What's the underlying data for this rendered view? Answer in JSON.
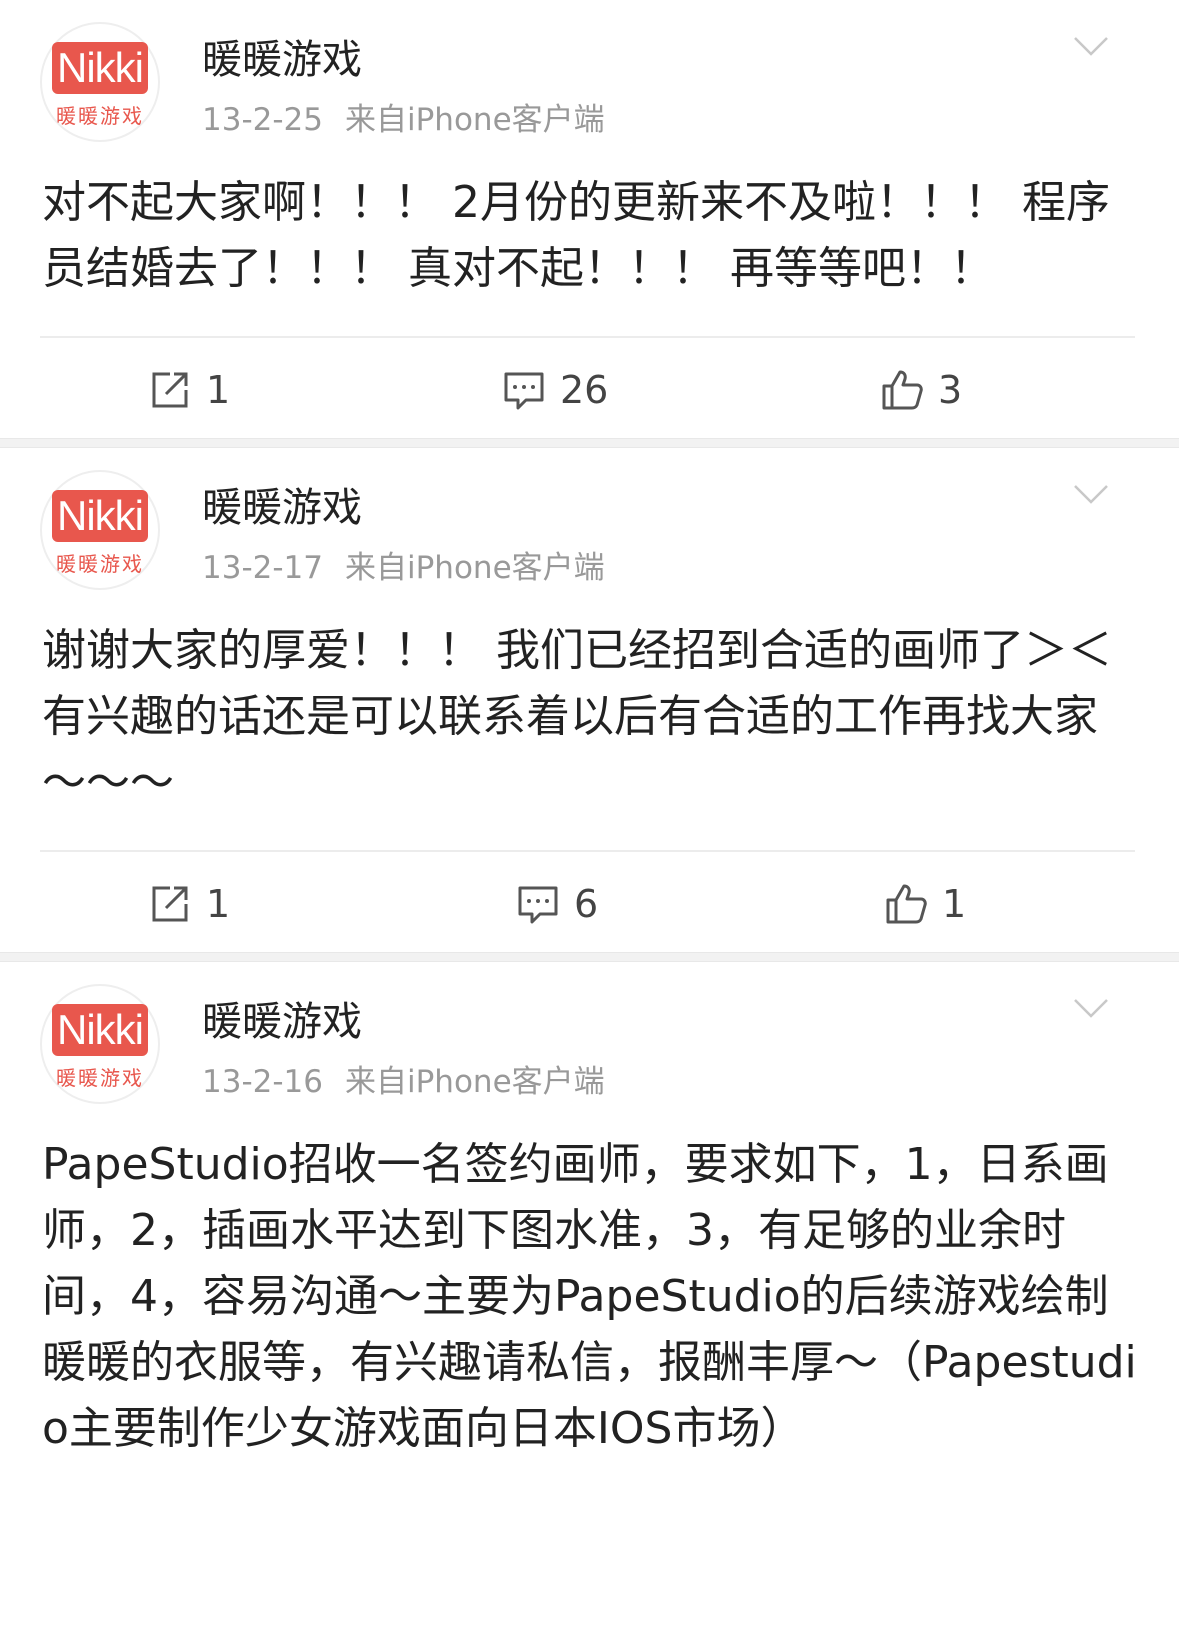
{
  "posts": [
    {
      "author": "暖暖游戏",
      "logo_text": "Nikki",
      "logo_sub": "暖暖游戏",
      "date": "13-2-25",
      "source": "来自iPhone客户端",
      "text": "对不起大家啊！！！ 2月份的更新来不及啦！！！ 程序员结婚去了！！！ 真对不起！！！ 再等等吧！！",
      "reposts": "1",
      "comments": "26",
      "likes": "3"
    },
    {
      "author": "暖暖游戏",
      "logo_text": "Nikki",
      "logo_sub": "暖暖游戏",
      "date": "13-2-17",
      "source": "来自iPhone客户端",
      "text": "谢谢大家的厚爱！！！ 我们已经招到合适的画师了＞＜有兴趣的话还是可以联系着以后有合适的工作再找大家～～～",
      "reposts": "1",
      "comments": "6",
      "likes": "1"
    },
    {
      "author": "暖暖游戏",
      "logo_text": "Nikki",
      "logo_sub": "暖暖游戏",
      "date": "13-2-16",
      "source": "来自iPhone客户端",
      "text": "PapeStudio招收一名签约画师，要求如下，1，日系画师，2，插画水平达到下图水准，3，有足够的业余时间，4，容易沟通～主要为PapeStudio的后续游戏绘制暖暖的衣服等，有兴趣请私信，报酬丰厚～（Papestudio主要制作少女游戏面向日本IOS市场）"
    }
  ],
  "icons": {
    "repost": "share-square-icon",
    "comment": "comment-bubble-icon",
    "like": "thumbs-up-icon",
    "menu": "chevron-down-icon"
  },
  "colors": {
    "logo": "#e8574d",
    "meta_text": "#999999",
    "body_text": "#222222",
    "divider": "#ececec"
  }
}
